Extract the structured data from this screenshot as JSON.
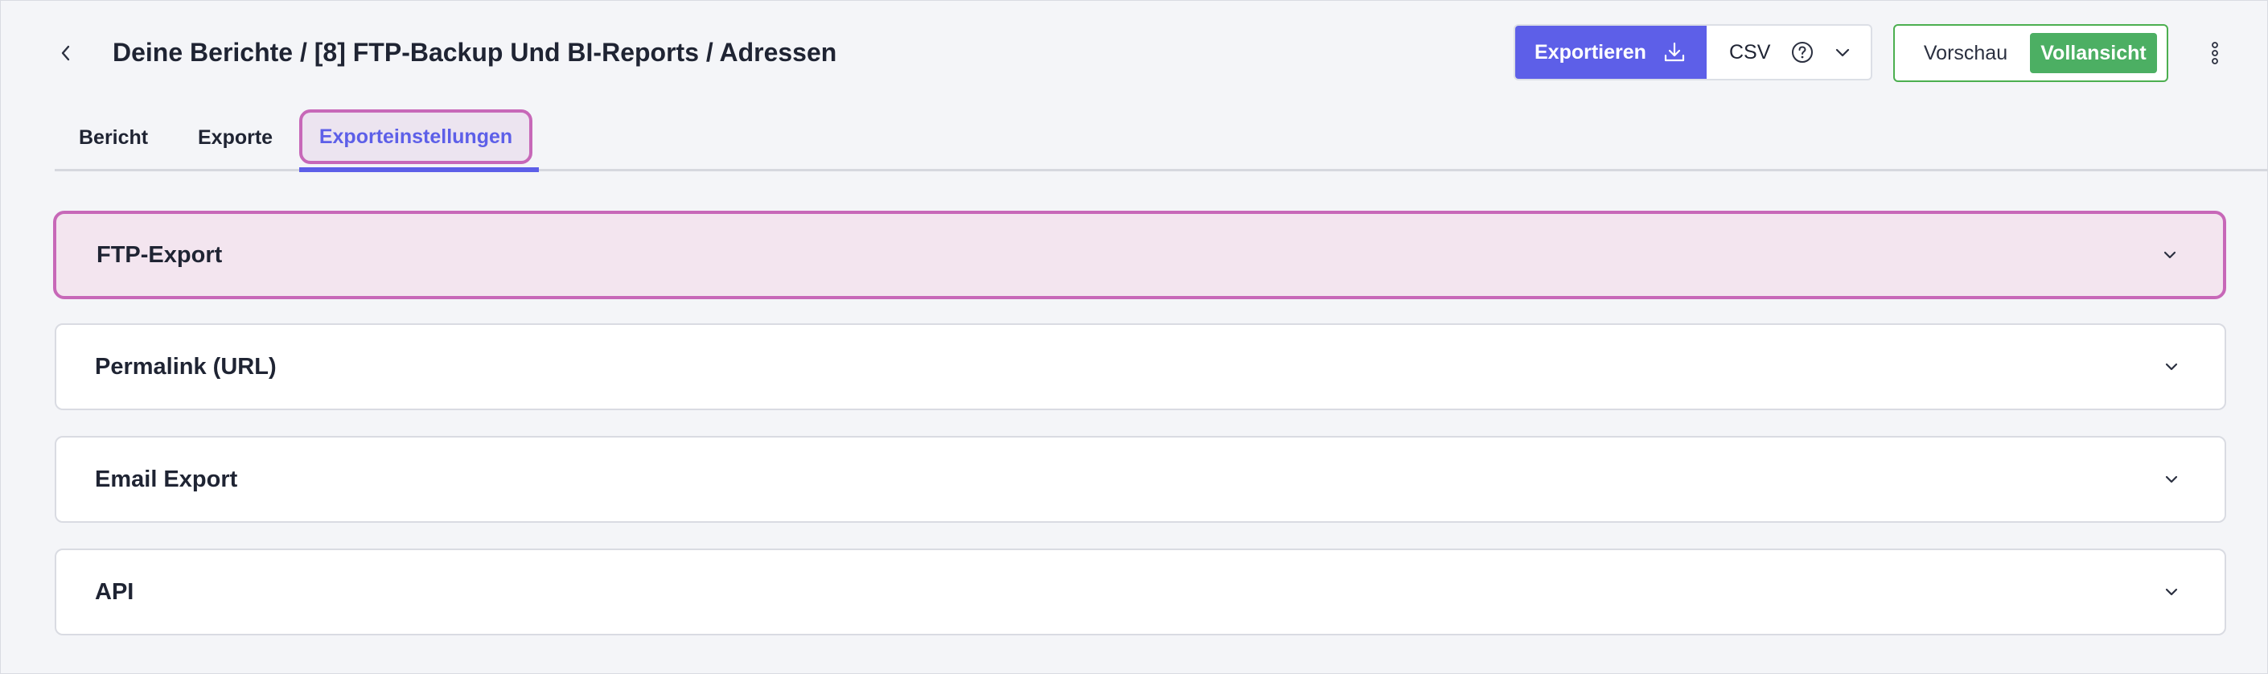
{
  "header": {
    "title": "Deine Berichte / [8] FTP-Backup Und BI-Reports / Adressen",
    "back_icon": "chevron-left-icon"
  },
  "toolbar": {
    "export_label": "Exportieren",
    "export_icon": "download-icon",
    "format_value": "CSV",
    "help_icon": "question-circle-icon",
    "format_dropdown_icon": "chevron-down-icon",
    "view_preview_label": "Vorschau",
    "view_full_label": "Vollansicht",
    "view_full_selected": true,
    "more_icon": "kebab-menu-icon"
  },
  "tabs": [
    {
      "label": "Bericht",
      "active": false
    },
    {
      "label": "Exporte",
      "active": false
    },
    {
      "label": "Exporteinstellungen",
      "active": true
    }
  ],
  "panels": [
    {
      "title": "FTP-Export",
      "expanded": false,
      "highlighted": true
    },
    {
      "title": "Permalink (URL)",
      "expanded": false
    },
    {
      "title": "Email Export",
      "expanded": false
    },
    {
      "title": "API",
      "expanded": false
    }
  ],
  "colors": {
    "primary": "#5d5fe8",
    "success": "#4caf63",
    "highlight_border": "#c768b8",
    "highlight_bg": "#f3e5ef",
    "page_bg": "#f4f5f8"
  }
}
